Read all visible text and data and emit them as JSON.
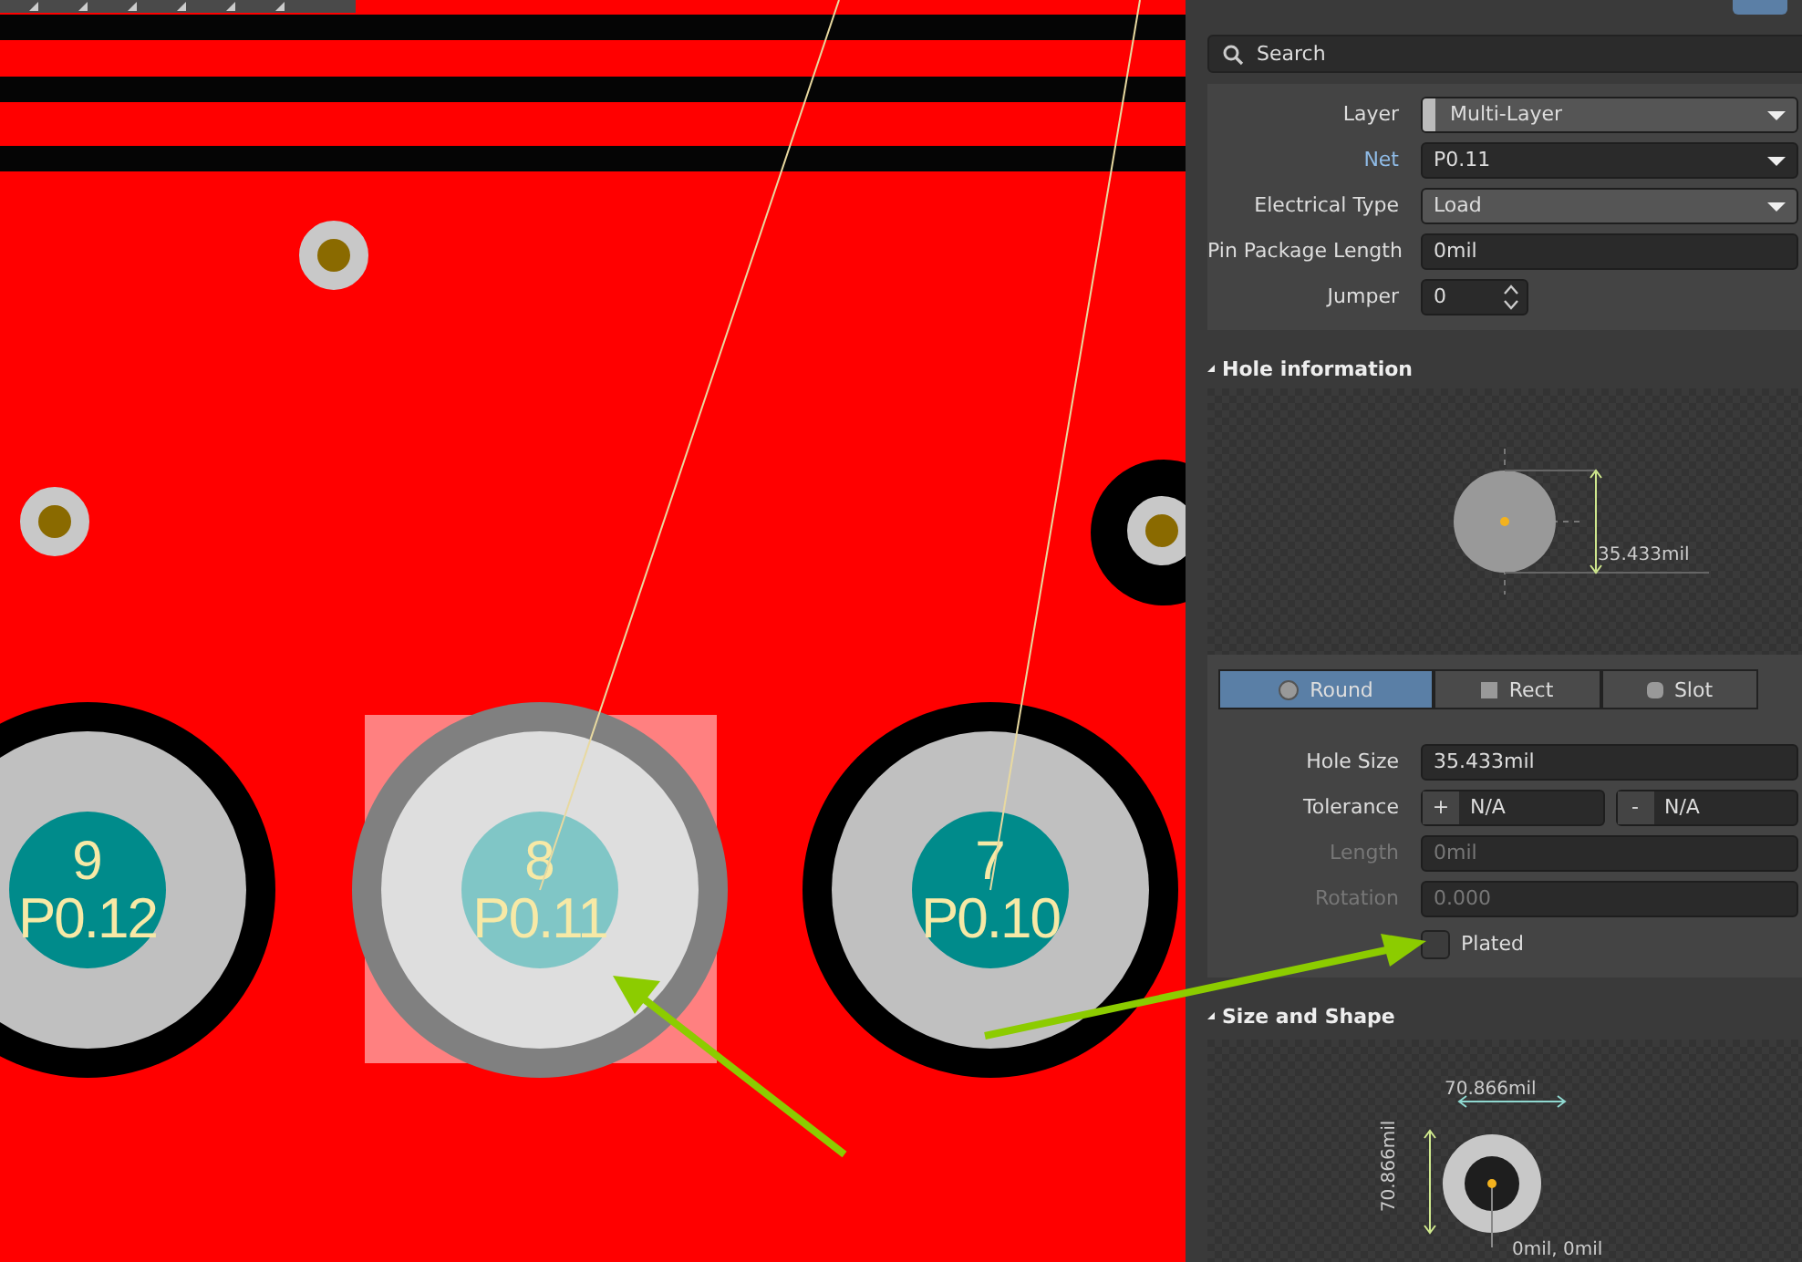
{
  "pcb": {
    "pads": [
      {
        "number": "9",
        "net": "P0.12",
        "selected": false
      },
      {
        "number": "8",
        "net": "P0.11",
        "selected": true
      },
      {
        "number": "7",
        "net": "P0.10",
        "selected": false
      }
    ]
  },
  "panel": {
    "search": {
      "placeholder": "Search"
    },
    "properties": [
      {
        "label": "Layer",
        "value": "Multi-Layer",
        "kind": "layer"
      },
      {
        "label": "Net",
        "value": "P0.11",
        "kind": "net"
      },
      {
        "label": "Electrical Type",
        "value": "Load",
        "kind": "dropdown"
      },
      {
        "label": "Pin Package Length",
        "value": "0mil",
        "kind": "text"
      },
      {
        "label": "Jumper",
        "value": "0",
        "kind": "spin"
      }
    ],
    "hole": {
      "title": "Hole information",
      "expanded": true,
      "dimension": "35.433mil",
      "shapes": [
        {
          "label": "Round",
          "selected": true
        },
        {
          "label": "Rect",
          "selected": false
        },
        {
          "label": "Slot",
          "selected": false
        }
      ],
      "fields": [
        {
          "label": "Hole Size",
          "value": "35.433mil",
          "kind": "text",
          "disabled": false
        },
        {
          "label": "Tolerance",
          "plus": "+",
          "plus_value": "N/A",
          "minus": "-",
          "minus_value": "N/A",
          "kind": "tolerance",
          "disabled": false
        },
        {
          "label": "Length",
          "value": "0mil",
          "kind": "text",
          "disabled": true
        },
        {
          "label": "Rotation",
          "value": "0.000",
          "kind": "text",
          "disabled": true
        }
      ],
      "plated": {
        "label": "Plated",
        "checked": false
      }
    },
    "size": {
      "title": "Size and Shape",
      "expanded": true,
      "width": "70.866mil",
      "height": "70.866mil",
      "offset": "0mil, 0mil"
    }
  }
}
